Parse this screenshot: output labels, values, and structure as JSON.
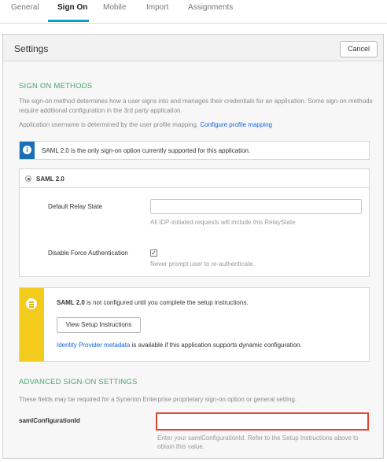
{
  "tabs": [
    {
      "label": "General"
    },
    {
      "label": "Sign On"
    },
    {
      "label": "Mobile"
    },
    {
      "label": "Import"
    },
    {
      "label": "Assignments"
    }
  ],
  "active_tab": "Sign On",
  "header": {
    "title": "Settings",
    "cancel_label": "Cancel"
  },
  "sign_on_methods": {
    "title": "SIGN ON METHODS",
    "description": "The sign-on method determines how a user signs into and manages their credentials for an application. Some sign-on methods require additional configuration in the 3rd party application.",
    "username_text": "Application username is determined by the user profile mapping.",
    "profile_link": "Configure profile mapping",
    "info_text": "SAML 2.0 is the only sign-on option currently supported for this application."
  },
  "saml": {
    "option_label": "SAML 2.0",
    "relay_state_label": "Default Relay State",
    "relay_state_value": "",
    "relay_state_hint": "All IDP-initiated requests will include this RelayState",
    "force_auth_label": "Disable Force Authentication",
    "force_auth_checked": true,
    "force_auth_hint": "Never prompt user to re-authenticate."
  },
  "setup": {
    "bold_prefix": "SAML 2.0",
    "message_rest": " is not configured until you complete the setup instructions.",
    "button_label": "View Setup Instructions",
    "metadata_link": "Identity Provider metadata",
    "metadata_rest": " is available if this application supports dynamic configuration."
  },
  "advanced": {
    "title": "ADVANCED SIGN-ON SETTINGS",
    "description": "These fields may be required for a Synerion Enterprise proprietary sign-on option or general setting.",
    "config_label": "samlConfigurationId",
    "config_value": "",
    "config_hint": "Enter your samlConfigurationId. Refer to the Setup Instructions above to obtain this value."
  },
  "colors": {
    "accent_teal": "#0aa0c8",
    "section_green": "#4ba36b",
    "link_blue": "#1662dd",
    "info_blue": "#1a6fb8",
    "warning_yellow": "#f2cb1d",
    "highlight_red": "#e8412c"
  },
  "icons": [
    "info-icon",
    "notice-list-icon",
    "checkbox-check-icon"
  ]
}
